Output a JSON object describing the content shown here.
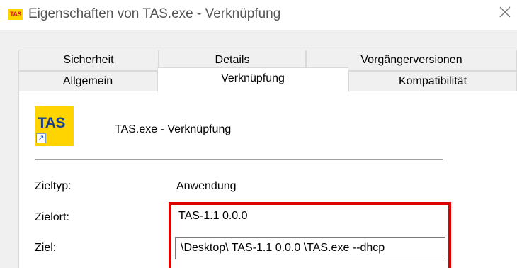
{
  "window": {
    "app_icon_text": "TAS",
    "title": "Eigenschaften von TAS.exe - Verknüpfung",
    "close_glyph": "╳"
  },
  "tabs": {
    "row1": [
      "Sicherheit",
      "Details",
      "Vorgängerversionen"
    ],
    "row2": [
      "Allgemein",
      "Verknüpfung",
      "Kompatibilität"
    ],
    "active": "Verknüpfung"
  },
  "shortcut": {
    "icon_text": "TAS",
    "icon_name": "tas-shortcut-icon",
    "name": "TAS.exe - Verknüpfung"
  },
  "properties": {
    "target_type_label": "Zieltyp:",
    "target_type_value": "Anwendung",
    "target_location_label": "Zielort:",
    "target_location_value": "TAS-1.1 0.0.0",
    "target_label": "Ziel:",
    "target_value": "\\Desktop\\ TAS-1.1 0.0.0 \\TAS.exe --dhcp"
  },
  "colors": {
    "highlight": "#e00000",
    "icon_background": "#ffd400"
  }
}
